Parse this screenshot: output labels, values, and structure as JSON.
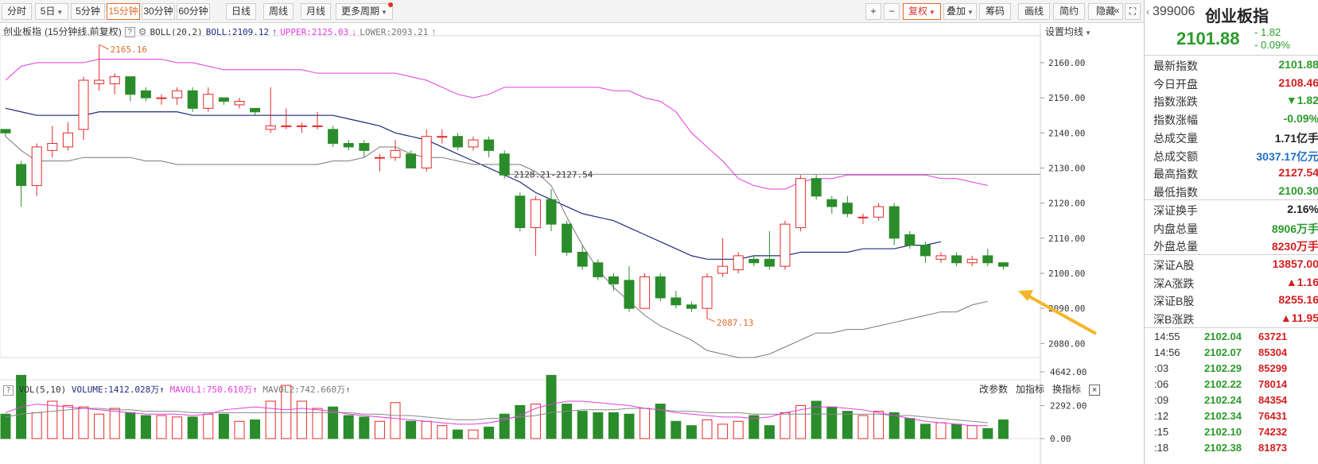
{
  "toolbar": {
    "periods": [
      "分时",
      "5日",
      "5分钟",
      "15分钟",
      "30分钟",
      "60分钟",
      "日线",
      "周线",
      "月线",
      "更多周期"
    ],
    "active_period": "15分钟",
    "right_buttons": [
      "复权",
      "叠加",
      "筹码",
      "画线",
      "简约",
      "隐藏"
    ],
    "zoom_in": "+",
    "zoom_out": "−",
    "collapse": "«",
    "fullscreen": "⛶"
  },
  "info": {
    "name": "创业板指",
    "sub": "(15分钟线,前复权)",
    "help": "?",
    "boll": "BOLL(20,2)",
    "boll_val": "BOLL:2109.12",
    "upper": "UPPER:2125.03",
    "lower": "LOWER:2093.21",
    "set_ma": "设置均线"
  },
  "vol_info": {
    "vol": "VOL(5,10)",
    "volume": "VOLUME:1412.028万",
    "mavol1": "MAVOL1:750.610万",
    "mavol2": "MAVOL2:742.660万",
    "btn_params": "改参数",
    "btn_add": "加指标",
    "btn_switch": "换指标",
    "close": "×"
  },
  "colors": {
    "up": "#e52a2a",
    "down": "#2b8c2b",
    "mid": "#1f2a7a",
    "upper": "#e23be0",
    "lower": "#777777",
    "vol_ma1": "#e23be0",
    "vol_ma2": "#888888",
    "arrow": "#f4b52a"
  },
  "chart_data": {
    "type": "candlestick",
    "price_axis": {
      "min": 2076,
      "max": 2167,
      "ticks": [
        "2160.00",
        "2150.00",
        "2140.00",
        "2130.00",
        "2120.00",
        "2110.00",
        "2100.00",
        "2090.00",
        "2080.00"
      ]
    },
    "volume_axis": {
      "ticks": [
        "4642.00",
        "2292.00",
        "0.00"
      ],
      "max": 4642
    },
    "annotations": {
      "high": "2165.16",
      "low": "2087.13",
      "hline": "2128.21-2127.54"
    },
    "candles": [
      {
        "o": 2141,
        "c": 2140,
        "h": 2141,
        "l": 2139
      },
      {
        "o": 2131,
        "c": 2125,
        "h": 2132,
        "l": 2119
      },
      {
        "o": 2125,
        "c": 2136,
        "h": 2137,
        "l": 2122
      },
      {
        "o": 2135,
        "c": 2137,
        "h": 2142,
        "l": 2133
      },
      {
        "o": 2136,
        "c": 2140,
        "h": 2143,
        "l": 2135
      },
      {
        "o": 2141,
        "c": 2155,
        "h": 2156,
        "l": 2138
      },
      {
        "o": 2154,
        "c": 2155,
        "h": 2165,
        "l": 2152
      },
      {
        "o": 2154,
        "c": 2156,
        "h": 2157,
        "l": 2151
      },
      {
        "o": 2156,
        "c": 2151,
        "h": 2156,
        "l": 2149
      },
      {
        "o": 2152,
        "c": 2150,
        "h": 2153,
        "l": 2149
      },
      {
        "o": 2150,
        "c": 2150,
        "h": 2151,
        "l": 2148
      },
      {
        "o": 2150,
        "c": 2152,
        "h": 2153,
        "l": 2148
      },
      {
        "o": 2152,
        "c": 2147,
        "h": 2153,
        "l": 2146
      },
      {
        "o": 2147,
        "c": 2151,
        "h": 2153,
        "l": 2146
      },
      {
        "o": 2150,
        "c": 2149,
        "h": 2150,
        "l": 2148
      },
      {
        "o": 2148,
        "c": 2149,
        "h": 2150,
        "l": 2147
      },
      {
        "o": 2147,
        "c": 2146,
        "h": 2147,
        "l": 2145
      },
      {
        "o": 2141,
        "c": 2142,
        "h": 2153,
        "l": 2140
      },
      {
        "o": 2142,
        "c": 2142,
        "h": 2147,
        "l": 2141
      },
      {
        "o": 2142,
        "c": 2142,
        "h": 2143,
        "l": 2140
      },
      {
        "o": 2142,
        "c": 2142,
        "h": 2146,
        "l": 2141
      },
      {
        "o": 2141,
        "c": 2137,
        "h": 2142,
        "l": 2136
      },
      {
        "o": 2137,
        "c": 2136,
        "h": 2138,
        "l": 2135
      },
      {
        "o": 2137,
        "c": 2135,
        "h": 2138,
        "l": 2133
      },
      {
        "o": 2133,
        "c": 2133,
        "h": 2134,
        "l": 2129
      },
      {
        "o": 2133,
        "c": 2135,
        "h": 2138,
        "l": 2132
      },
      {
        "o": 2134,
        "c": 2130,
        "h": 2135,
        "l": 2130
      },
      {
        "o": 2130,
        "c": 2139,
        "h": 2141,
        "l": 2129
      },
      {
        "o": 2139,
        "c": 2139,
        "h": 2141,
        "l": 2137
      },
      {
        "o": 2139,
        "c": 2136,
        "h": 2140,
        "l": 2135
      },
      {
        "o": 2136,
        "c": 2138,
        "h": 2139,
        "l": 2135
      },
      {
        "o": 2138,
        "c": 2135,
        "h": 2139,
        "l": 2133
      },
      {
        "o": 2134,
        "c": 2128,
        "h": 2135,
        "l": 2127
      },
      {
        "o": 2122,
        "c": 2113,
        "h": 2123,
        "l": 2112
      },
      {
        "o": 2113,
        "c": 2121,
        "h": 2122,
        "l": 2105
      },
      {
        "o": 2121,
        "c": 2114,
        "h": 2124,
        "l": 2112
      },
      {
        "o": 2114,
        "c": 2106,
        "h": 2115,
        "l": 2105
      },
      {
        "o": 2106,
        "c": 2102,
        "h": 2108,
        "l": 2101
      },
      {
        "o": 2103,
        "c": 2099,
        "h": 2104,
        "l": 2098
      },
      {
        "o": 2099,
        "c": 2097,
        "h": 2100,
        "l": 2095
      },
      {
        "o": 2098,
        "c": 2090,
        "h": 2102,
        "l": 2089
      },
      {
        "o": 2090,
        "c": 2099,
        "h": 2100,
        "l": 2090
      },
      {
        "o": 2099,
        "c": 2093,
        "h": 2100,
        "l": 2092
      },
      {
        "o": 2093,
        "c": 2091,
        "h": 2095,
        "l": 2090
      },
      {
        "o": 2091,
        "c": 2090,
        "h": 2092,
        "l": 2089
      },
      {
        "o": 2090,
        "c": 2099,
        "h": 2100,
        "l": 2087
      },
      {
        "o": 2100,
        "c": 2102,
        "h": 2110,
        "l": 2099
      },
      {
        "o": 2101,
        "c": 2105,
        "h": 2106,
        "l": 2100
      },
      {
        "o": 2104,
        "c": 2103,
        "h": 2105,
        "l": 2102
      },
      {
        "o": 2104,
        "c": 2102,
        "h": 2112,
        "l": 2101
      },
      {
        "o": 2102,
        "c": 2114,
        "h": 2115,
        "l": 2101
      },
      {
        "o": 2113,
        "c": 2127,
        "h": 2128,
        "l": 2112
      },
      {
        "o": 2127,
        "c": 2122,
        "h": 2128,
        "l": 2121
      },
      {
        "o": 2121,
        "c": 2119,
        "h": 2122,
        "l": 2117
      },
      {
        "o": 2120,
        "c": 2117,
        "h": 2122,
        "l": 2116
      },
      {
        "o": 2116,
        "c": 2116,
        "h": 2117,
        "l": 2114
      },
      {
        "o": 2116,
        "c": 2119,
        "h": 2120,
        "l": 2115
      },
      {
        "o": 2119,
        "c": 2110,
        "h": 2120,
        "l": 2108
      },
      {
        "o": 2111,
        "c": 2108,
        "h": 2112,
        "l": 2107
      },
      {
        "o": 2108,
        "c": 2105,
        "h": 2109,
        "l": 2103
      },
      {
        "o": 2104,
        "c": 2105,
        "h": 2106,
        "l": 2103
      },
      {
        "o": 2105,
        "c": 2103,
        "h": 2106,
        "l": 2102
      },
      {
        "o": 2103,
        "c": 2104,
        "h": 2105,
        "l": 2102
      },
      {
        "o": 2105,
        "c": 2103,
        "h": 2107,
        "l": 2102
      },
      {
        "o": 2103,
        "c": 2102,
        "h": 2103,
        "l": 2101
      }
    ],
    "upper_line": [
      2155,
      2159,
      2160,
      2160,
      2160,
      2160,
      2161,
      2161,
      2161,
      2161,
      2161,
      2160,
      2160,
      2159,
      2158,
      2158,
      2158,
      2158,
      2158,
      2158,
      2157,
      2157,
      2157,
      2157,
      2157,
      2157,
      2156,
      2155,
      2153,
      2151,
      2150,
      2151,
      2153,
      2153,
      2153,
      2153,
      2153,
      2153,
      2153,
      2152,
      2152,
      2150,
      2149,
      2146,
      2140,
      2136,
      2132,
      2127,
      2125,
      2124,
      2124,
      2126,
      2127,
      2127,
      2128,
      2128,
      2128,
      2128,
      2128,
      2128,
      2127,
      2127,
      2126,
      2125
    ],
    "mid_line": [
      2147,
      2146,
      2145,
      2145,
      2145,
      2145,
      2146,
      2146,
      2146,
      2146,
      2146,
      2146,
      2145,
      2145,
      2145,
      2145,
      2145,
      2145,
      2145,
      2145,
      2145,
      2145,
      2144,
      2143,
      2142,
      2140,
      2139,
      2138,
      2136,
      2134,
      2132,
      2130,
      2128,
      2126,
      2123,
      2121,
      2119,
      2117,
      2116,
      2115,
      2113,
      2111,
      2109,
      2107,
      2105,
      2104,
      2104,
      2104,
      2105,
      2105,
      2105,
      2106,
      2106,
      2106,
      2106,
      2107,
      2107,
      2107,
      2108,
      2108,
      2109
    ],
    "lower_line": [
      2139,
      2135,
      2132,
      2132,
      2132,
      2133,
      2133,
      2133,
      2133,
      2132,
      2132,
      2131,
      2131,
      2131,
      2131,
      2131,
      2131,
      2131,
      2131,
      2131,
      2131,
      2132,
      2132,
      2133,
      2136,
      2136,
      2134,
      2133,
      2133,
      2132,
      2131,
      2131,
      2131,
      2131,
      2129,
      2125,
      2116,
      2108,
      2101,
      2096,
      2092,
      2088,
      2085,
      2083,
      2081,
      2078,
      2077,
      2076,
      2076,
      2077,
      2079,
      2081,
      2083,
      2083,
      2084,
      2084,
      2085,
      2086,
      2087,
      2088,
      2089,
      2089,
      2091,
      2092
    ],
    "volumes": [
      1700,
      4400,
      1800,
      2600,
      2300,
      2200,
      1700,
      2100,
      1800,
      1600,
      1600,
      1500,
      1500,
      1700,
      1700,
      1200,
      1300,
      2600,
      3700,
      2600,
      2100,
      2200,
      1600,
      1500,
      1200,
      2500,
      1200,
      1200,
      900,
      600,
      600,
      800,
      1700,
      2300,
      2400,
      4400,
      2400,
      1900,
      1800,
      1800,
      1700,
      2100,
      2400,
      1200,
      900,
      1300,
      1000,
      1200,
      1600,
      900,
      1800,
      2300,
      2600,
      2200,
      1900,
      1600,
      1900,
      1800,
      1400,
      1000,
      1100,
      1000,
      900,
      700,
      1300
    ],
    "vol_ma1": [
      1800,
      2200,
      2400,
      2300,
      2200,
      2100,
      2000,
      1900,
      1800,
      1700,
      1700,
      1700,
      1600,
      1700,
      2000,
      2100,
      2200,
      2100,
      2000,
      2100,
      2000,
      1900,
      1700,
      1600,
      1500,
      1400,
      1300,
      1200,
      1100,
      1000,
      1000,
      1100,
      1300,
      1600,
      2100,
      2400,
      2600,
      2600,
      2500,
      2400,
      2300,
      2100,
      2000,
      1800,
      1700,
      1600,
      1500,
      1500,
      1400,
      1500,
      1800,
      2000,
      2200,
      2200,
      2100,
      2000,
      1800,
      1600,
      1400,
      1200,
      1100,
      1000,
      900,
      900
    ],
    "vol_ma2": [
      1500,
      1700,
      1800,
      1900,
      2000,
      2100,
      2100,
      2000,
      2000,
      1900,
      1900,
      1900,
      1800,
      1800,
      1800,
      1800,
      1800,
      1800,
      1800,
      1800,
      1800,
      1800,
      1800,
      1700,
      1700,
      1600,
      1600,
      1500,
      1400,
      1300,
      1300,
      1400,
      1400,
      1500,
      1600,
      1800,
      1900,
      2000,
      2000,
      2000,
      2100,
      2100,
      2000,
      1900,
      1900,
      1800,
      1800,
      1800,
      1700,
      1700,
      1700,
      1700,
      1700,
      1700,
      1700,
      1700,
      1700,
      1600,
      1600,
      1500,
      1400,
      1300,
      1200,
      1100
    ]
  },
  "quote": {
    "code": "399006",
    "name": "创业板指",
    "price": "2101.88",
    "change": "- 1.82",
    "change_pct": "- 0.09%",
    "rows": [
      {
        "label": "最新指数",
        "value": "2101.88",
        "color": "#2b9a2b"
      },
      {
        "label": "今日开盘",
        "value": "2108.46",
        "color": "#d21e1e"
      },
      {
        "label": "指数涨跌",
        "value": "▼1.82",
        "color": "#2b9a2b"
      },
      {
        "label": "指数涨幅",
        "value": "-0.09%",
        "color": "#2b9a2b"
      },
      {
        "label": "总成交量",
        "value": "1.71亿手",
        "color": "#222"
      },
      {
        "label": "总成交额",
        "value": "3037.17亿元",
        "color": "#1f6fc5"
      },
      {
        "label": "最高指数",
        "value": "2127.54",
        "color": "#d21e1e"
      },
      {
        "label": "最低指数",
        "value": "2100.30",
        "color": "#2b9a2b"
      }
    ],
    "rows2": [
      {
        "label": "深证换手",
        "value": "2.16%",
        "color": "#222"
      },
      {
        "label": "内盘总量",
        "value": "8906万手",
        "color": "#2b9a2b"
      },
      {
        "label": "外盘总量",
        "value": "8230万手",
        "color": "#d21e1e"
      }
    ],
    "rows3": [
      {
        "label": "深证A股",
        "value": "13857.00",
        "color": "#d21e1e"
      },
      {
        "label": "深A涨跌",
        "value": "▲1.16",
        "color": "#d21e1e"
      },
      {
        "label": "深证B股",
        "value": "8255.16",
        "color": "#d21e1e"
      },
      {
        "label": "深B涨跌",
        "value": "▲11.95",
        "color": "#d21e1e"
      }
    ],
    "ticks": [
      {
        "time": "14:55",
        "price": "2102.04",
        "vol": "63721"
      },
      {
        "time": "14:56",
        "price": "2102.07",
        "vol": "85304"
      },
      {
        "time": ":03",
        "price": "2102.29",
        "vol": "85299"
      },
      {
        "time": ":06",
        "price": "2102.22",
        "vol": "78014"
      },
      {
        "time": ":09",
        "price": "2102.24",
        "vol": "84354"
      },
      {
        "time": ":12",
        "price": "2102.34",
        "vol": "76431"
      },
      {
        "time": ":15",
        "price": "2102.10",
        "vol": "74232"
      },
      {
        "time": ":18",
        "price": "2102.38",
        "vol": "81873"
      }
    ]
  }
}
